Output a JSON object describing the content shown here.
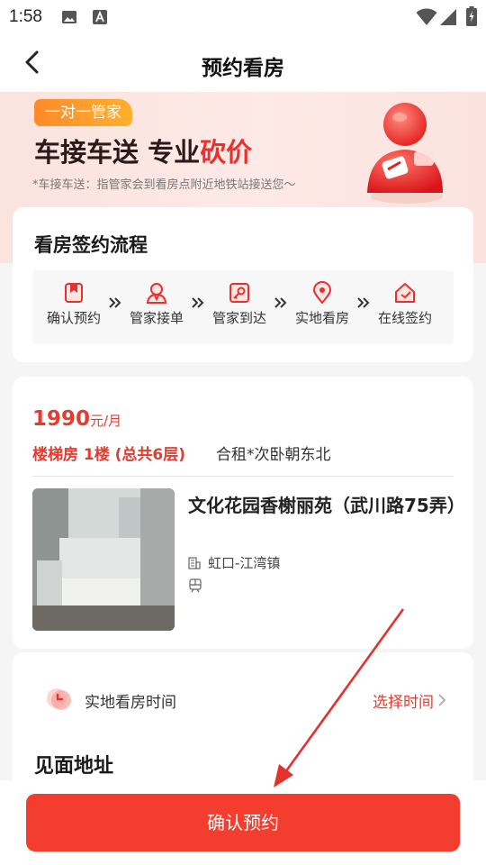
{
  "status_bar": {
    "time": "1:58"
  },
  "header": {
    "title": "预约看房"
  },
  "banner": {
    "tag": "一对一管家",
    "slogan_main": "车接车送 专业",
    "slogan_highlight": "砍价",
    "note": "*车接车送：指管家会到看房点附近地铁站接送您～"
  },
  "process": {
    "title": "看房签约流程",
    "steps": [
      {
        "label": "确认预约",
        "icon": "bookmark-icon"
      },
      {
        "label": "管家接单",
        "icon": "person-icon"
      },
      {
        "label": "管家到达",
        "icon": "key-icon"
      },
      {
        "label": "实地看房",
        "icon": "location-pin-icon"
      },
      {
        "label": "在线签约",
        "icon": "home-icon"
      }
    ]
  },
  "listing": {
    "price": "1990",
    "price_unit": "元/月",
    "floor": "楼梯房 1楼 (总共6层)",
    "room_type": "合租*次卧朝东北",
    "name": "文化花园香榭丽苑（武川路75弄）",
    "district": "虹口-江湾镇"
  },
  "schedule": {
    "label": "实地看房时间",
    "select_label": "选择时间"
  },
  "meeting": {
    "title": "见面地址"
  },
  "bottom": {
    "confirm_label": "确认预约"
  },
  "colors": {
    "accent": "#f23d2f",
    "price": "#e63b2e",
    "tag_orange": "#ff9a2c"
  }
}
